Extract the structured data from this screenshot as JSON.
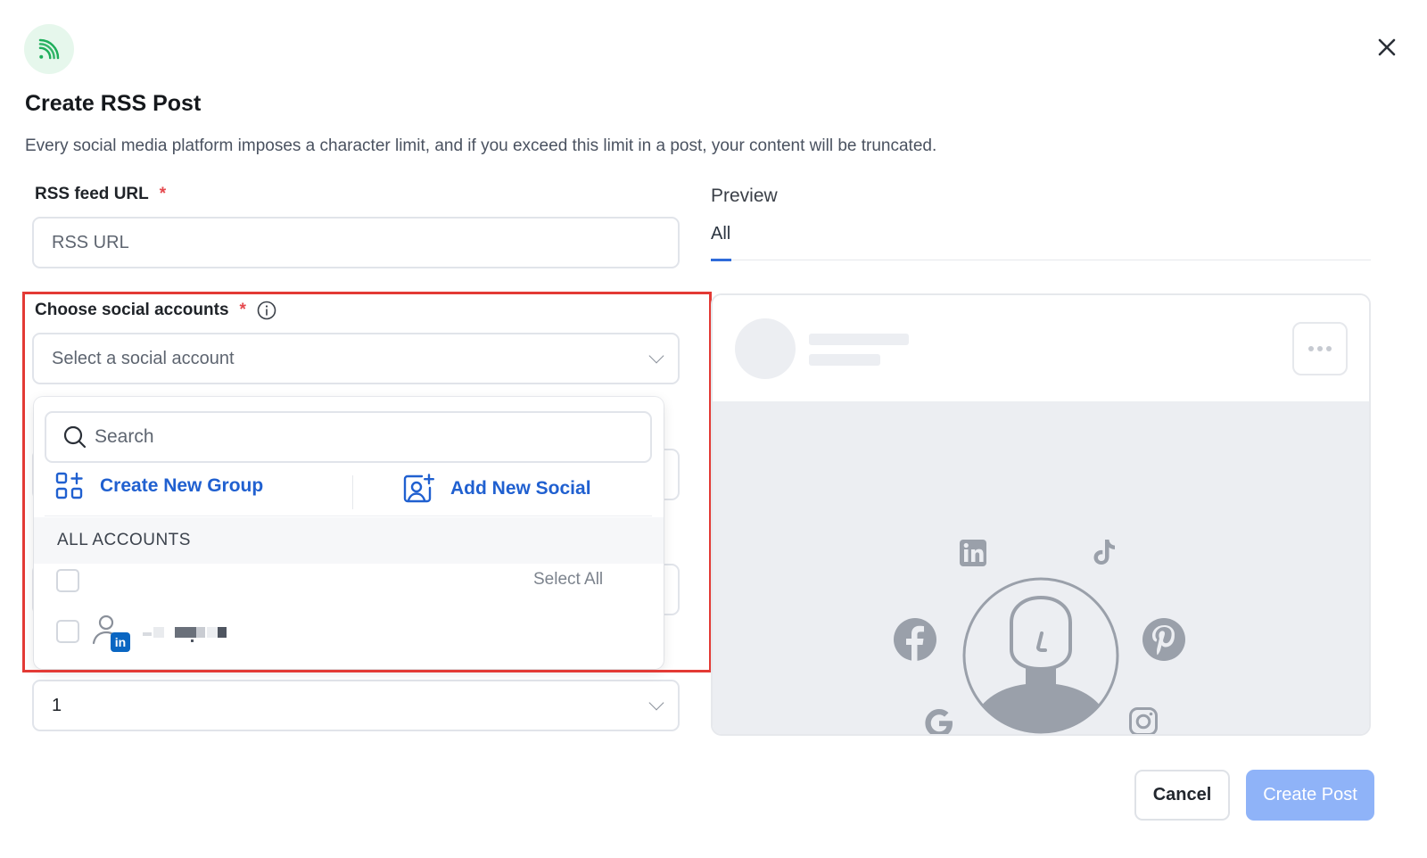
{
  "header": {
    "icon": "rss-icon",
    "title": "Create RSS Post",
    "subtitle": "Every social media platform imposes a character limit, and if you exceed this limit in a post, your content will be truncated.",
    "close_icon": "close-icon"
  },
  "rss_feed": {
    "label": "RSS feed URL",
    "required_mark": "*",
    "placeholder": "RSS URL",
    "value": ""
  },
  "social_accounts": {
    "label": "Choose social accounts",
    "required_mark": "*",
    "info_icon": "info-icon",
    "select_placeholder": "Select a social account",
    "dropdown": {
      "search_placeholder": "Search",
      "create_group_label": "Create New Group",
      "add_social_label": "Add New Social",
      "section_header": "ALL ACCOUNTS",
      "select_all_label": "Select All",
      "accounts": [
        {
          "network": "linkedin",
          "name_redacted": true
        }
      ]
    }
  },
  "count_select": {
    "value": "1"
  },
  "preview": {
    "label": "Preview",
    "tabs": [
      {
        "label": "All",
        "active": true
      }
    ],
    "platform_icons": [
      "linkedin-icon",
      "tiktok-icon",
      "facebook-icon",
      "pinterest-icon",
      "google-icon",
      "instagram-icon"
    ]
  },
  "footer": {
    "cancel_label": "Cancel",
    "create_label": "Create Post"
  },
  "colors": {
    "accent_blue": "#2060d0",
    "primary_disabled": "#8fb3f8",
    "required_red": "#e5484d",
    "highlight_red": "#e33a35",
    "rss_green": "#1fae5b",
    "icon_gray": "#9aa0aa"
  }
}
